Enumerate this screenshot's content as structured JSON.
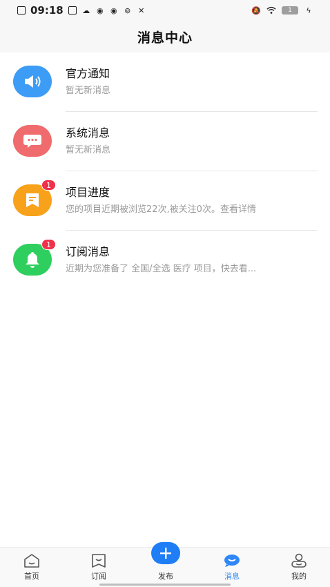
{
  "status_bar": {
    "time": "09:18",
    "battery_level": "1"
  },
  "header": {
    "title": "消息中心"
  },
  "messages": [
    {
      "title": "官方通知",
      "subtitle": "暂无新消息",
      "badge": "",
      "color": "#3d9cf5",
      "icon": "speaker-icon"
    },
    {
      "title": "系统消息",
      "subtitle": "暂无新消息",
      "badge": "",
      "color": "#f06b6d",
      "icon": "chat-bubble-icon"
    },
    {
      "title": "项目进度",
      "subtitle": "您的项目近期被浏览22次,被关注0次。查看详情",
      "badge": "1",
      "color": "#f7a21a",
      "icon": "document-icon"
    },
    {
      "title": "订阅消息",
      "subtitle": "近期为您准备了 全国/全选 医疗 项目，快去看...",
      "badge": "1",
      "color": "#2ecf5e",
      "icon": "bell-icon"
    }
  ],
  "tabbar": {
    "home": "首页",
    "subscribe": "订阅",
    "publish": "发布",
    "messages": "消息",
    "mine": "我的",
    "active_color": "#2f86f6"
  }
}
